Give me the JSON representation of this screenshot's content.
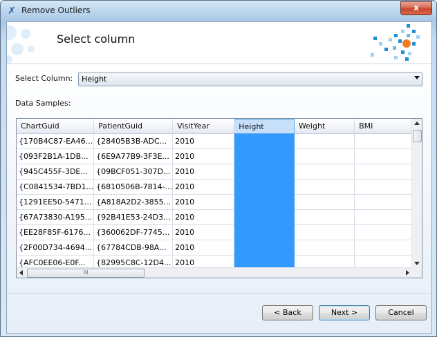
{
  "window": {
    "title": "Remove Outliers",
    "close_label": "x"
  },
  "header": {
    "title": "Select column"
  },
  "select_column": {
    "label": "Select Column:",
    "value": "Height"
  },
  "samples": {
    "label": "Data Samples:",
    "columns": [
      "ChartGuid",
      "PatientGuid",
      "VisitYear",
      "Height",
      "Weight",
      "BMI"
    ],
    "selected_column": "Height",
    "rows": [
      [
        "{170B4C87-EA46...",
        "{28405B3B-ADC...",
        "2010",
        "",
        "",
        ""
      ],
      [
        "{093F2B1A-1DB...",
        "{6E9A77B9-3F3E...",
        "2010",
        "",
        "",
        ""
      ],
      [
        "{945C455F-3DE...",
        "{09BCF051-307D...",
        "2010",
        "",
        "",
        ""
      ],
      [
        "{C0841534-7BD1...",
        "{6810506B-7814-...",
        "2010",
        "",
        "",
        ""
      ],
      [
        "{1291EE50-5471...",
        "{A818A2D2-3855...",
        "2010",
        "",
        "",
        ""
      ],
      [
        "{67A73830-A195...",
        "{92B41E53-24D3...",
        "2010",
        "",
        "",
        ""
      ],
      [
        "{EE28F85F-6176...",
        "{360062DF-7745...",
        "2010",
        "",
        "",
        ""
      ],
      [
        "{2F00D734-4694...",
        "{67784CDB-98A...",
        "2010",
        "",
        "",
        ""
      ],
      [
        "{AFC0EE06-E0F...",
        "{82995C8C-12D4...",
        "2010",
        "",
        "",
        ""
      ]
    ],
    "hscroll_grip": "III"
  },
  "buttons": {
    "back": "< Back",
    "next": "Next >",
    "cancel": "Cancel"
  },
  "colors": {
    "selection": "#3399ff",
    "close": "#c7442a",
    "logo_orange": "#f47a20",
    "logo_blue": "#1f8fd6"
  }
}
